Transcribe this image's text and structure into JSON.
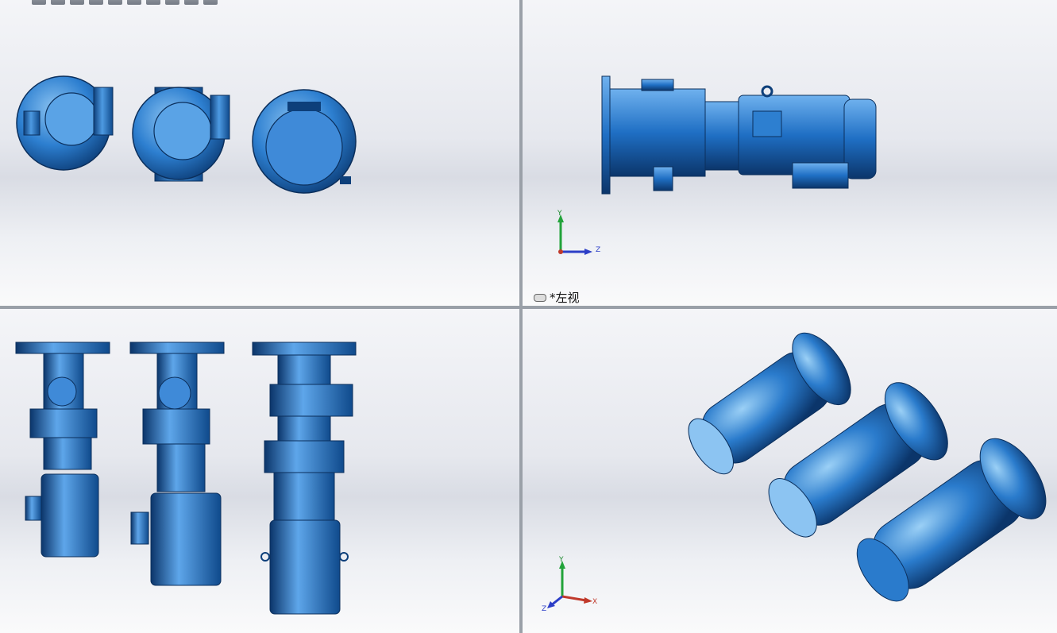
{
  "viewports": {
    "top_left": {
      "name": "front-view-viewport"
    },
    "top_right": {
      "name": "left-view-viewport",
      "view_label": "*左视",
      "triad": {
        "y": "Y",
        "z": "Z"
      }
    },
    "bottom_left": {
      "name": "top-view-viewport"
    },
    "bottom_right": {
      "name": "isometric-viewport",
      "triad": {
        "y": "Y",
        "x": "X",
        "z": "Z"
      }
    }
  },
  "toolbar": {
    "icons": [
      "zoom-fit-icon",
      "zoom-area-icon",
      "previous-view-icon",
      "section-view-icon",
      "view-orientation-icon",
      "display-style-icon",
      "hide-show-icon",
      "edit-appearance-icon",
      "apply-scene-icon",
      "view-settings-icon"
    ]
  },
  "colors": {
    "model_blue": "#1f6fc4",
    "model_dark": "#0d3f7a",
    "model_light": "#7fb9ee",
    "divider": "#9aa0a8"
  }
}
